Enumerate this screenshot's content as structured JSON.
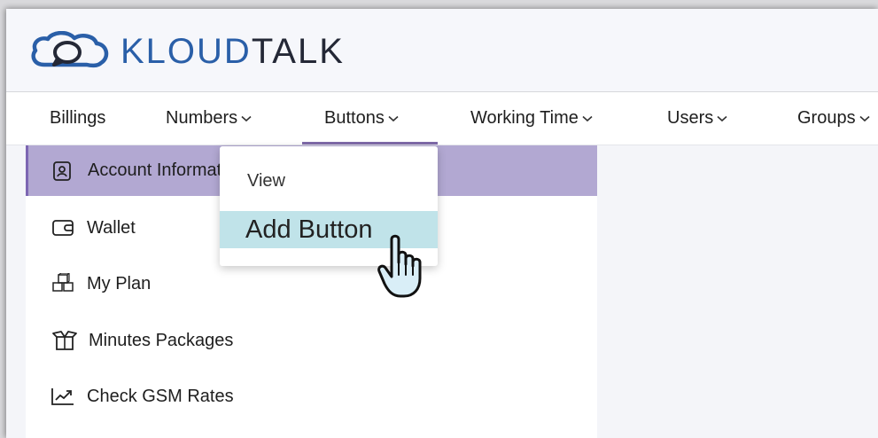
{
  "brand": {
    "name_part1": "KLOUD",
    "name_part2": "TALK",
    "logo_icon": "cloud-chat-icon"
  },
  "nav": {
    "items": [
      {
        "label": "Billings",
        "has_dropdown": false
      },
      {
        "label": "Numbers",
        "has_dropdown": true
      },
      {
        "label": "Buttons",
        "has_dropdown": true,
        "active": true
      },
      {
        "label": "Working Time",
        "has_dropdown": true
      },
      {
        "label": "Users",
        "has_dropdown": true
      },
      {
        "label": "Groups",
        "has_dropdown": true
      }
    ]
  },
  "dropdown": {
    "items": [
      {
        "label": "View"
      },
      {
        "label": "Add Button",
        "hovered": true
      }
    ]
  },
  "sidebar": {
    "items": [
      {
        "label": "Account Informat",
        "icon": "account-info-icon",
        "active": true
      },
      {
        "label": "Wallet",
        "icon": "wallet-icon"
      },
      {
        "label": "My Plan",
        "icon": "cubes-icon"
      },
      {
        "label": "Minutes Packages",
        "icon": "package-icon"
      },
      {
        "label": "Check GSM Rates",
        "icon": "rates-chart-icon"
      }
    ]
  },
  "colors": {
    "brand_blue": "#2a5fa8",
    "brand_dark": "#242836",
    "active_bg": "#b2a8d2",
    "active_border": "#7c66b2",
    "hover_bg": "#c0e3e9",
    "nav_underline": "#7e6aa8"
  }
}
